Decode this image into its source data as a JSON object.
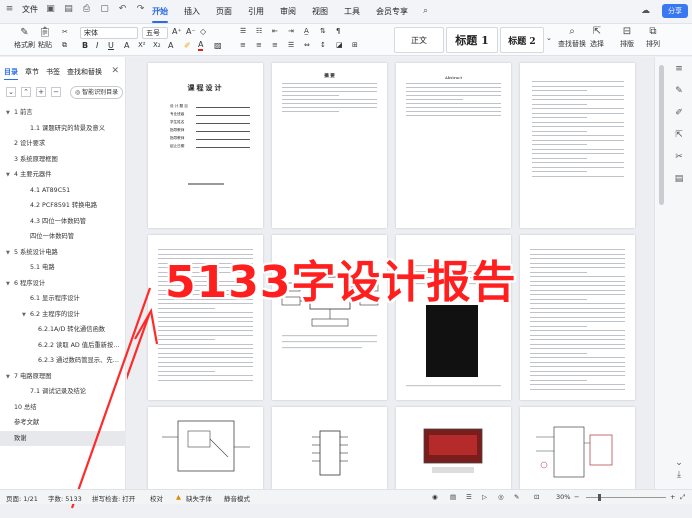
{
  "menubar": {
    "file_label": "文件",
    "tabs": [
      "开始",
      "插入",
      "页面",
      "引用",
      "审阅",
      "视图",
      "工具",
      "会员专享"
    ],
    "active_tab": "开始",
    "share_label": "分享"
  },
  "ribbon": {
    "format_painter": "格式刷",
    "paste": "粘贴",
    "font_name": "宋体",
    "font_size": "五号",
    "styles": [
      "正文",
      "标题 1",
      "标题 2"
    ],
    "find_replace": "查找替换",
    "select": "选择",
    "layout": "排版",
    "arrange": "排列"
  },
  "nav": {
    "tabs": [
      "目录",
      "章节",
      "书签",
      "查找和替换"
    ],
    "active_tab": "目录",
    "smart_toc": "智能识别目录",
    "items": [
      {
        "text": "1  前言",
        "level": 1,
        "arrow": "▼"
      },
      {
        "text": "1.1 课题研究的背景及意义",
        "level": 2,
        "arrow": ""
      },
      {
        "text": "2  设计要求",
        "level": 1,
        "arrow": ""
      },
      {
        "text": "3 系统原理框图",
        "level": 1,
        "arrow": ""
      },
      {
        "text": "4  主要元器件",
        "level": 1,
        "arrow": "▼"
      },
      {
        "text": "4.1    AT89C51",
        "level": 2,
        "arrow": ""
      },
      {
        "text": "4.2    PCF8591 转换电路",
        "level": 2,
        "arrow": ""
      },
      {
        "text": "4.3 四位一体数码管",
        "level": 2,
        "arrow": ""
      },
      {
        "text": "四位一体数码管",
        "level": 1.5,
        "arrow": ""
      },
      {
        "text": "5 系统设计电路",
        "level": 1,
        "arrow": "▼"
      },
      {
        "text": "5.1 电路",
        "level": 2,
        "arrow": ""
      },
      {
        "text": "6 程序设计",
        "level": 1,
        "arrow": "▼"
      },
      {
        "text": "6.1  显示程序设计",
        "level": 2,
        "arrow": ""
      },
      {
        "text": "6.2  主程序的设计",
        "level": 2,
        "arrow": "▼"
      },
      {
        "text": "6.2.1A/D 转化通信函数",
        "level": 3,
        "arrow": ""
      },
      {
        "text": "6.2.2 读取 AD 值后重新按键设置...",
        "level": 3,
        "arrow": ""
      },
      {
        "text": "6.2.3 通过数码管显示、先计...",
        "level": 3,
        "arrow": ""
      },
      {
        "text": "7  电路原理图",
        "level": 1,
        "arrow": "▼"
      },
      {
        "text": "7.1 调试记录及结论",
        "level": 2,
        "arrow": ""
      },
      {
        "text": "10  总结",
        "level": 1,
        "arrow": ""
      },
      {
        "text": "参考文献",
        "level": 1,
        "arrow": ""
      },
      {
        "text": "致谢",
        "level": 1,
        "arrow": "",
        "selected": true
      }
    ]
  },
  "pages": {
    "cover_title": "课程设计",
    "cover_fields": [
      "设 计 题 目",
      "专业班级",
      "学生姓名",
      "指导教师",
      "指导教师",
      "起止日期"
    ],
    "abstract_title": "摘 要",
    "english_title": "Abstract"
  },
  "overlay": {
    "text": "5133字设计报告",
    "color": "#ff1f1f"
  },
  "status": {
    "page": "页面: 1/21",
    "words": "字数: 5133",
    "spellcheck": "拼写检查: 打开",
    "proofread": "校对",
    "missing_font": "缺失字体",
    "reading_mode": "静音模式",
    "zoom": "30%"
  }
}
